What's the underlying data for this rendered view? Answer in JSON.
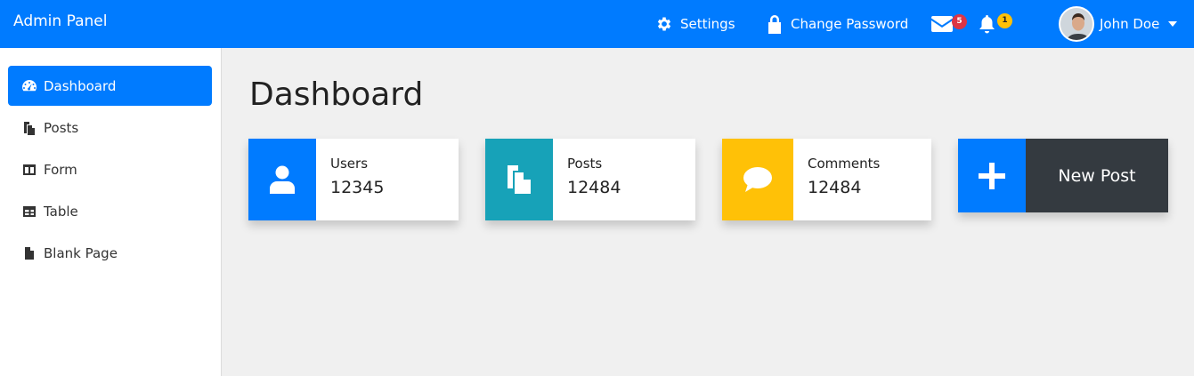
{
  "navbar": {
    "brand": "Admin Panel",
    "settings_label": "Settings",
    "change_password_label": "Change Password",
    "messages_count": "5",
    "notifications_count": "1",
    "user_name": "John Doe"
  },
  "sidebar": {
    "items": [
      {
        "label": "Dashboard",
        "icon": "tachometer-icon"
      },
      {
        "label": "Posts",
        "icon": "files-icon"
      },
      {
        "label": "Form",
        "icon": "columns-icon"
      },
      {
        "label": "Table",
        "icon": "table-icon"
      },
      {
        "label": "Blank Page",
        "icon": "file-icon"
      }
    ]
  },
  "main": {
    "title": "Dashboard",
    "cards": [
      {
        "label": "Users",
        "value": "12345",
        "color": "#007bff",
        "icon": "user-icon"
      },
      {
        "label": "Posts",
        "value": "12484",
        "color": "#17a2b8",
        "icon": "files-icon"
      },
      {
        "label": "Comments",
        "value": "12484",
        "color": "#ffc107",
        "icon": "comment-icon"
      }
    ],
    "new_post_label": "New Post"
  },
  "colors": {
    "primary": "#007bff",
    "info": "#17a2b8",
    "warning": "#ffc107",
    "danger": "#dc3545",
    "dark": "#343a40"
  }
}
